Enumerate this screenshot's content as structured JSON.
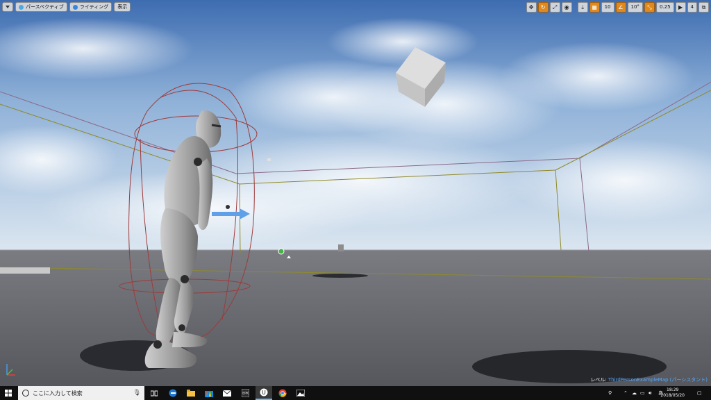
{
  "viewport": {
    "toolbar_left": {
      "perspective_label": "パースペクティブ",
      "lighting_label": "ライティング",
      "show_label": "表示"
    },
    "toolbar_right": {
      "grid_snap_value": "10",
      "rotation_snap_value": "10°",
      "scale_snap_value": "0.25",
      "camera_speed_value": "4"
    },
    "level_info": {
      "prefix": "レベル:",
      "map_name": "ThirdPersonExampleMap",
      "suffix": "(パーシスタント)"
    }
  },
  "taskbar": {
    "search_placeholder": "ここに入力して検索",
    "clock_time": "18:29",
    "clock_date": "2018/05/20",
    "ime_label": "あ",
    "apps": [
      "task-view",
      "edge",
      "file-explorer",
      "store",
      "mail",
      "epic-launcher",
      "unreal-engine",
      "chrome",
      "photos"
    ]
  },
  "colors": {
    "sky_top": "#3d6cb0",
    "floor": "#6f7177",
    "accent_orange": "#e08a1e",
    "level_map_blue": "#55aaff",
    "capsule_wire": "#9e3a3a",
    "bounds_wire": "#8f8a2a"
  }
}
